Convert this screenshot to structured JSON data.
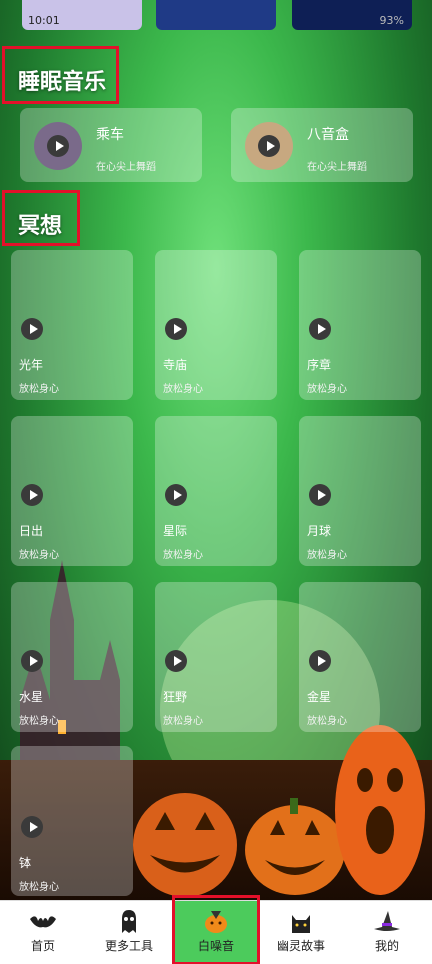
{
  "status_bar": {
    "time": "10:01",
    "battery": "93%"
  },
  "sleep_music": {
    "title": "睡眠音乐",
    "items": [
      {
        "name": "乘车",
        "subtitle": "在心尖上舞蹈"
      },
      {
        "name": "八音盒",
        "subtitle": "在心尖上舞蹈"
      }
    ]
  },
  "meditation": {
    "title": "冥想",
    "items": [
      {
        "name": "光年",
        "subtitle": "放松身心"
      },
      {
        "name": "寺庙",
        "subtitle": "放松身心"
      },
      {
        "name": "序章",
        "subtitle": "放松身心"
      },
      {
        "name": "日出",
        "subtitle": "放松身心"
      },
      {
        "name": "星际",
        "subtitle": "放松身心"
      },
      {
        "name": "月球",
        "subtitle": "放松身心"
      },
      {
        "name": "水星",
        "subtitle": "放松身心"
      },
      {
        "name": "狂野",
        "subtitle": "放松身心"
      },
      {
        "name": "金星",
        "subtitle": "放松身心"
      },
      {
        "name": "钵",
        "subtitle": "放松身心"
      }
    ]
  },
  "tabbar": {
    "active_color": "#4ccb5c",
    "tabs": [
      {
        "label": "首页",
        "icon": "bat-icon"
      },
      {
        "label": "更多工具",
        "icon": "ghost-icon"
      },
      {
        "label": "白噪音",
        "icon": "pumpkin-icon"
      },
      {
        "label": "幽灵故事",
        "icon": "cat-icon"
      },
      {
        "label": "我的",
        "icon": "witch-hat-icon"
      }
    ]
  },
  "highlight_color": "#e3102a"
}
